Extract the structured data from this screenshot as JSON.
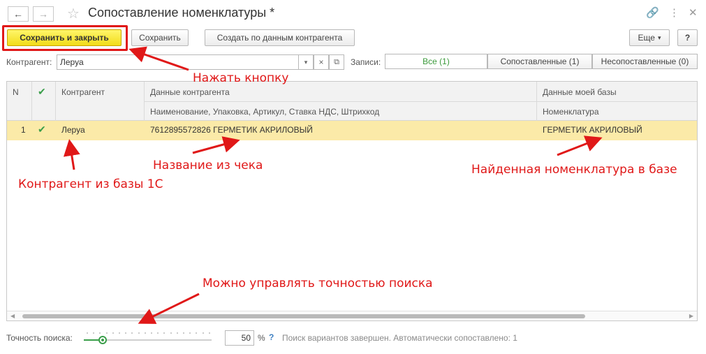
{
  "window": {
    "title": "Сопоставление номенклатуры *",
    "back_icon": "arrow-left-icon",
    "forward_icon": "arrow-right-icon",
    "favorite_icon": "star-icon",
    "link_icon": "link-icon",
    "menu_icon": "more-vertical-icon",
    "close_icon": "close-icon"
  },
  "toolbar": {
    "save_close_label": "Сохранить и закрыть",
    "save_label": "Сохранить",
    "create_label": "Создать по данным контрагента",
    "more_label": "Еще",
    "help_label": "?"
  },
  "filter": {
    "counterparty_label": "Контрагент:",
    "counterparty_value": "Леруа",
    "records_label": "Записи:",
    "segments": [
      "Все (1)",
      "Сопоставленные (1)",
      "Несопоставленные (0)"
    ],
    "active_segment": 0
  },
  "table": {
    "columns": {
      "n": "N",
      "counterparty": "Контрагент",
      "counterparty_data": "Данные контрагента",
      "counterparty_data_sub": "Наименование, Упаковка, Артикул, Ставка НДС, Штрихкод",
      "my_data": "Данные моей базы",
      "my_data_sub": "Номенклатура"
    },
    "rows": [
      {
        "n": "1",
        "matched": true,
        "counterparty": "Леруа",
        "counterparty_data": "7612895572826  ГЕРМЕТИК АКРИЛОВЫЙ",
        "nomenclature": "ГЕРМЕТИК АКРИЛОВЫЙ"
      }
    ]
  },
  "annotations": {
    "press_button": "Нажать кнопку",
    "receipt_name": "Название из чека",
    "found_item": "Найденная номенклатура в базе",
    "counterparty_from_db": "Контрагент из базы 1С",
    "search_accuracy": "Можно управлять точностью поиска"
  },
  "bottom": {
    "accuracy_label": "Точность поиска:",
    "accuracy_value": "50",
    "accuracy_percent": 50,
    "percent_sign": "%",
    "help": "?",
    "status": "Поиск вариантов завершен. Автоматически сопоставлено: 1"
  },
  "colors": {
    "accent_green": "#3a9e4a",
    "highlight_row": "#fbeaa8",
    "primary_button": "#f2dc1a",
    "annotation_red": "#e01818"
  }
}
